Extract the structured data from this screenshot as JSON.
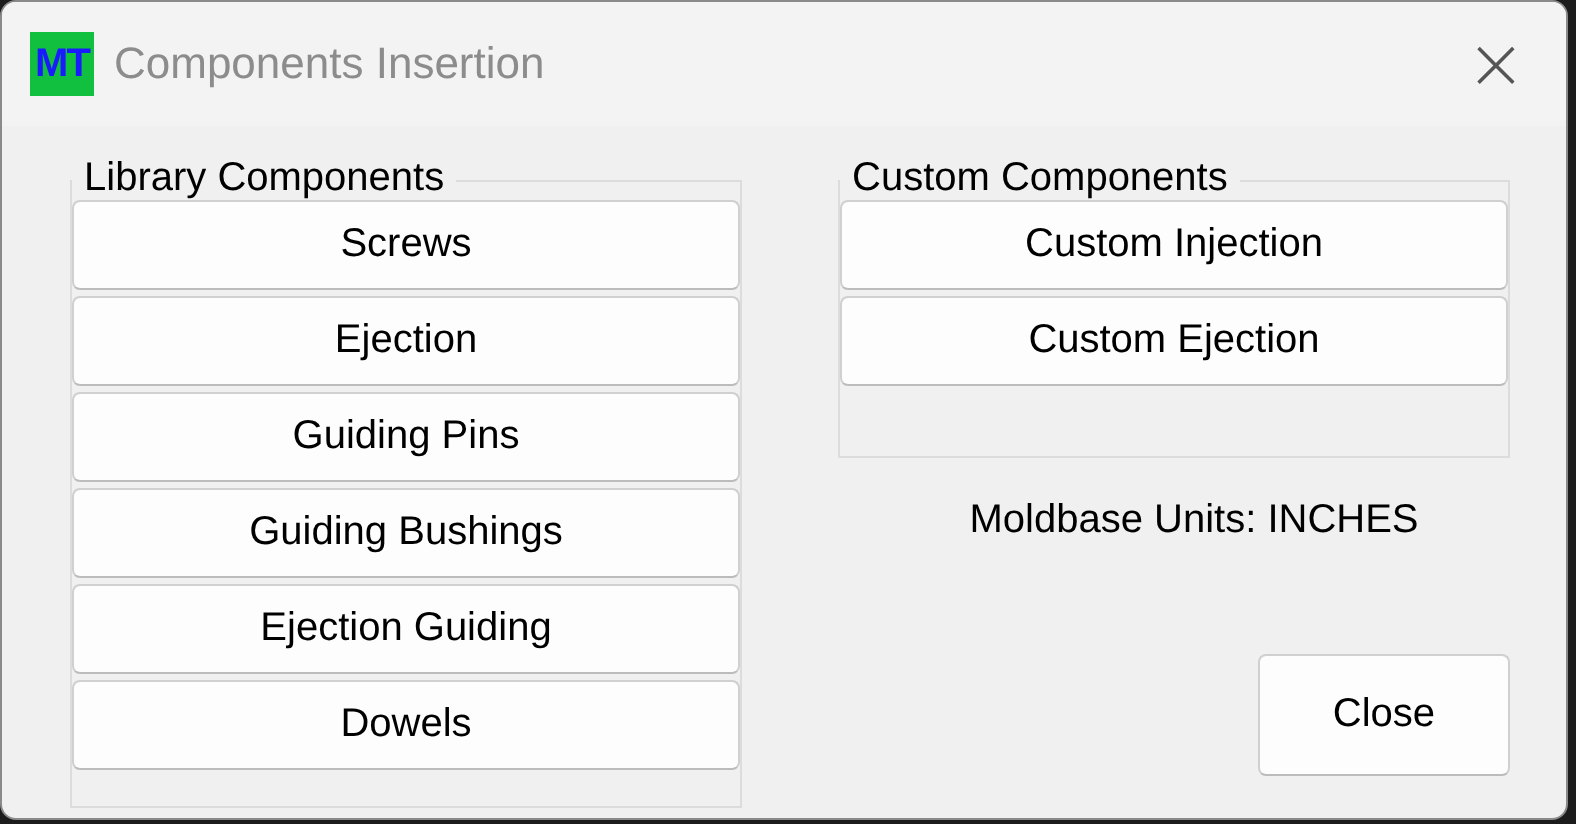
{
  "window": {
    "app_badge": "MT",
    "title": "Components Insertion",
    "close_glyph": "×"
  },
  "library": {
    "title": "Library Components",
    "buttons": [
      "Screws",
      "Ejection",
      "Guiding Pins",
      "Guiding Bushings",
      "Ejection Guiding",
      "Dowels"
    ]
  },
  "custom": {
    "title": "Custom Components",
    "buttons": [
      "Custom Injection",
      "Custom Ejection"
    ]
  },
  "units_label": "Moldbase Units: INCHES",
  "close_button": "Close"
}
